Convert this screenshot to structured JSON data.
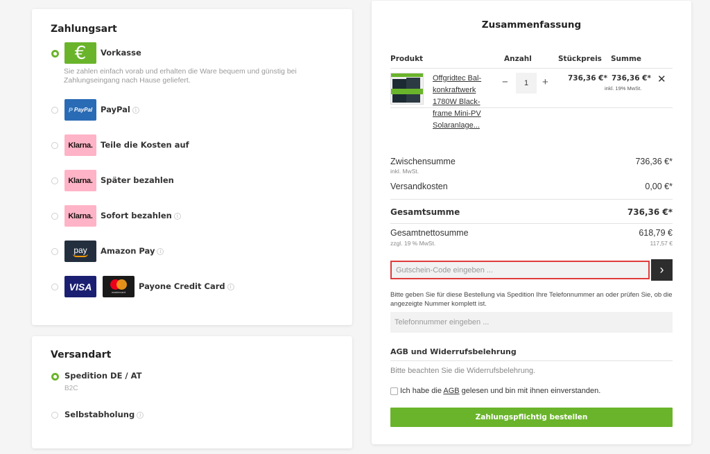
{
  "payment": {
    "title": "Zahlungsart",
    "methods": [
      {
        "label": "Vorkasse",
        "logo_text": "€",
        "selected": true,
        "description": "Sie zahlen einfach vorab und erhalten die Ware bequem und günstig bei Zahlungseingang nach Hause geliefert."
      },
      {
        "label": "PayPal",
        "logo_text": "PayPal",
        "selected": false
      },
      {
        "label": "Teile die Kosten auf",
        "logo_text": "Klarna.",
        "selected": false
      },
      {
        "label": "Später bezahlen",
        "logo_text": "Klarna.",
        "selected": false
      },
      {
        "label": "Sofort bezahlen",
        "logo_text": "Klarna.",
        "selected": false
      },
      {
        "label": "Amazon Pay",
        "logo_text": "pay",
        "selected": false
      },
      {
        "label": "Payone Credit Card",
        "logo_text": "VISA",
        "logo_text_2": "mastercard",
        "selected": false
      }
    ]
  },
  "shipping": {
    "title": "Versandart",
    "methods": [
      {
        "label": "Spedition DE / AT",
        "sub": "B2C",
        "selected": true
      },
      {
        "label": "Selbstabholung",
        "selected": false
      }
    ]
  },
  "summary": {
    "title": "Zusammenfassung",
    "headers": {
      "product": "Produkt",
      "qty": "Anzahl",
      "unit": "Stückpreis",
      "total": "Summe"
    },
    "item": {
      "name": "Offgridtec Bal-konkraftwerk 1780W Black-frame Mini-PV Solaranlage...",
      "qty": "1",
      "unit_price": "736,36 €*",
      "total": "736,36 €*",
      "tax_note": "inkl. 19% MwSt."
    },
    "subtotal": {
      "label": "Zwischensumme",
      "sub": "inkl. MwSt.",
      "value": "736,36 €*"
    },
    "shipping_cost": {
      "label": "Versandkosten",
      "value": "0,00 €*"
    },
    "grand_total": {
      "label": "Gesamtsumme",
      "value": "736,36 €*"
    },
    "net_total": {
      "label": "Gesamtnettosumme",
      "sub": "zzgl. 19 % MwSt.",
      "value": "618,79 €",
      "tax_value": "117,57 €"
    },
    "voucher_placeholder": "Gutschein-Code eingeben ...",
    "phone_note": "Bitte geben Sie für diese Bestellung via Spedition Ihre Telefonnummer an oder prüfen Sie, ob die angezeigte Nummer komplett ist.",
    "phone_placeholder": "Telefonnummer eingeben ...",
    "agb_title": "AGB und Widerrufsbelehrung",
    "agb_text": "Bitte beachten Sie die Widerrufsbelehrung.",
    "agb_check_pre": "Ich habe die ",
    "agb_check_link": "AGB",
    "agb_check_post": " gelesen und bin mit ihnen einverstanden.",
    "order_button": "Zahlungspflichtig bestellen"
  },
  "colors": {
    "accent": "#6ab42b",
    "highlight_border": "#e03a3a"
  }
}
